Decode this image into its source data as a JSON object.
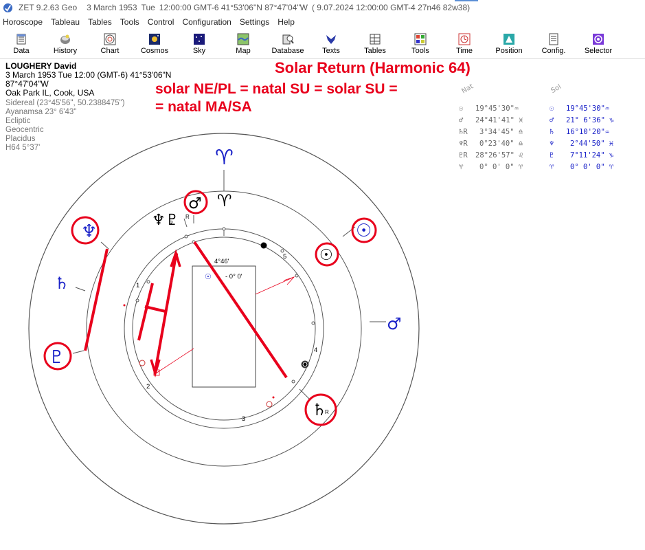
{
  "titlebar": {
    "app": "ZET 9.2.63 Geo",
    "date": "3 March 1953",
    "weekday": "Tue",
    "time": "12:00:00 GMT-6 41°53'06\"N  87°47'04\"W",
    "extra": "( 9.07.2024  12:00:00 GMT-4 27n46 82w38)"
  },
  "menu": [
    "Horoscope",
    "Tableau",
    "Tables",
    "Tools",
    "Control",
    "Configuration",
    "Settings",
    "Help"
  ],
  "toolbar": [
    {
      "label": "Data",
      "icon": "data-icon"
    },
    {
      "label": "History",
      "icon": "history-icon"
    },
    {
      "label": "Chart",
      "icon": "chart-icon"
    },
    {
      "label": "Cosmos",
      "icon": "cosmos-icon"
    },
    {
      "label": "Sky",
      "icon": "sky-icon"
    },
    {
      "label": "Map",
      "icon": "map-icon"
    },
    {
      "label": "Database",
      "icon": "database-icon"
    },
    {
      "label": "Texts",
      "icon": "texts-icon"
    },
    {
      "label": "Tables",
      "icon": "tables-icon"
    },
    {
      "label": "Tools",
      "icon": "tools-icon"
    },
    {
      "label": "Time",
      "icon": "time-icon"
    },
    {
      "label": "Position",
      "icon": "position-icon"
    },
    {
      "label": "Config.",
      "icon": "config-icon"
    },
    {
      "label": "Selector",
      "icon": "selector-icon"
    }
  ],
  "info": {
    "name": "LOUGHERY David",
    "datetime": "3 March 1953  Tue  12:00 (GMT-6) 41°53'06\"N  87°47'04\"W",
    "place": "Oak Park IL, Cook, USA",
    "sidereal": "Sidereal (23°45'56\", 50.2388475\")",
    "ayanamsa": "Ayanamsa 23° 6'43\"",
    "ecliptic": "Ecliptic",
    "geocentric": "Geocentric",
    "houses": "Placidus",
    "harmonic": "H64   5°37'"
  },
  "annotation": {
    "title": "Solar Return (Harmonic 64)",
    "line1": "solar NE/PL = natal SU = solar SU =",
    "line2": "= natal MA/SA"
  },
  "wheel": {
    "box_label": "4°46'",
    "box_sun_value": "- 0° 0'",
    "house_numbers": [
      "1",
      "2",
      "3",
      "4",
      "5"
    ],
    "aries_top": "♈",
    "aries_inner": "♈",
    "sun_glyph": "☉",
    "mars_glyph": "♂",
    "neptune_glyph": "♆",
    "saturn_glyph": "♄",
    "pluto_glyph": "♇",
    "retro": "R",
    "inner_cluster": "♆♇"
  },
  "positions_table": {
    "header_nat": "Nat",
    "header_sol": "Sol",
    "rows": [
      {
        "glyph_nat": "☉",
        "nat": "19°45'30\"♒",
        "glyph_sol": "☉",
        "sol": "19°45'30\"♒"
      },
      {
        "glyph_nat": "♂",
        "nat": "24°41'41\" ♓",
        "glyph_sol": "♂",
        "sol": "21° 6'36\" ♑"
      },
      {
        "glyph_nat": "♄R",
        "nat": "3°34'45\" ♎",
        "glyph_sol": "♄",
        "sol": "16°10'20\"♒"
      },
      {
        "glyph_nat": "♆R",
        "nat": "0°23'40\" ♎",
        "glyph_sol": "♆",
        "sol": "2°44'50\" ♓"
      },
      {
        "glyph_nat": "♇R",
        "nat": "28°26'57\" ♌",
        "glyph_sol": "♇",
        "sol": "7°11'24\" ♑"
      },
      {
        "glyph_nat": "♈",
        "nat": "0° 0' 0\" ♈",
        "glyph_sol": "♈",
        "sol": "0° 0' 0\" ♈"
      }
    ]
  },
  "colors": {
    "annotation_red": "#e8001c",
    "planet_blue": "#1a22c8",
    "wheel_gray": "#555555"
  }
}
